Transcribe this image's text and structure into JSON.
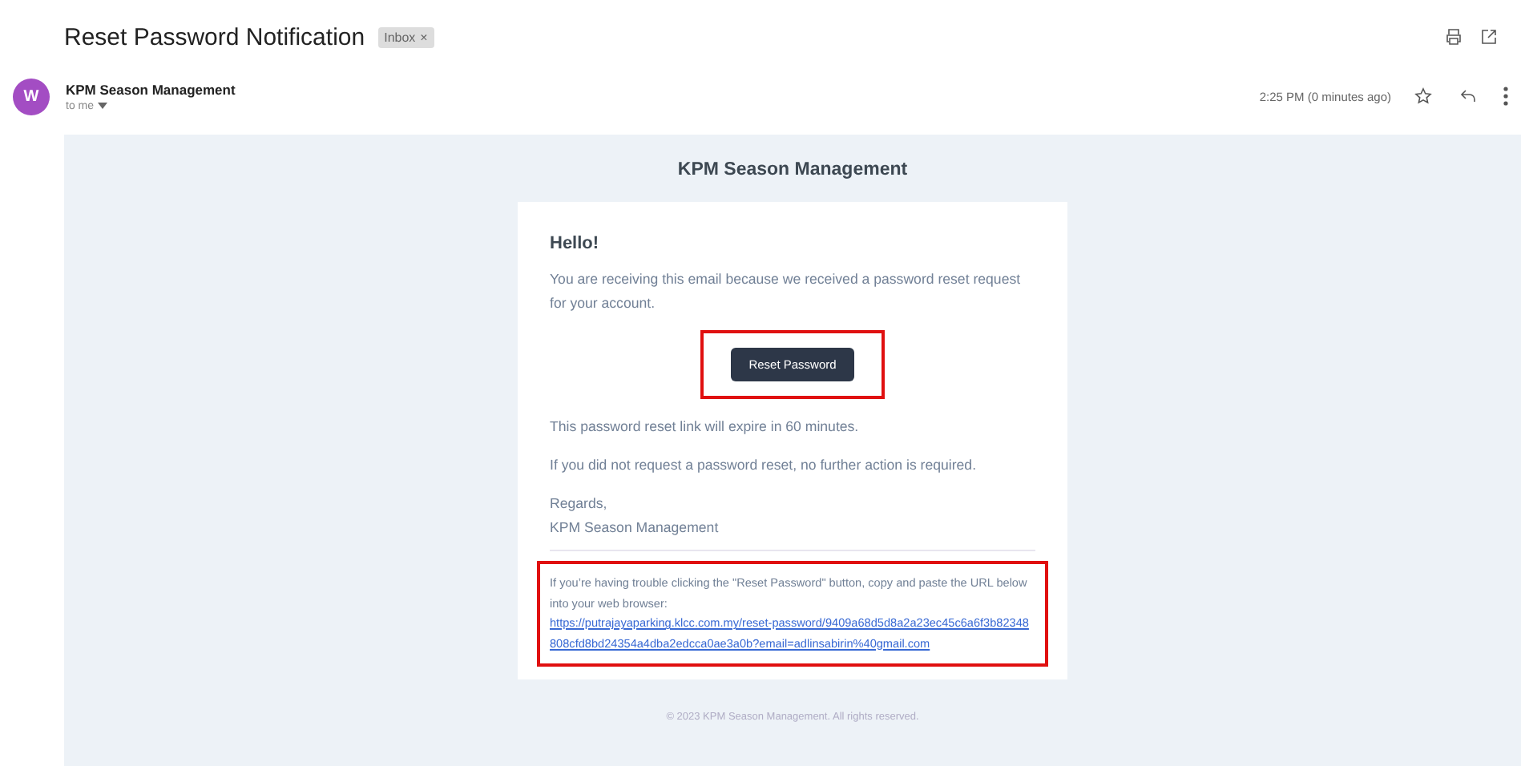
{
  "subject": "Reset Password Notification",
  "label": {
    "text": "Inbox",
    "close": "×"
  },
  "sender": {
    "avatar": "W",
    "name": "KPM Season Management",
    "recipient": "to me"
  },
  "time": "2:25 PM (0 minutes ago)",
  "email": {
    "brand": "KPM Season Management",
    "greeting": "Hello!",
    "intro": "You are receiving this email because we received a password reset request for your account.",
    "button": "Reset Password",
    "button_highlighted": true,
    "lines": [
      "This password reset link will expire in 60 minutes.",
      "If you did not request a password reset, no further action is required."
    ],
    "signoff": [
      "Regards,",
      "KPM Season Management"
    ],
    "trouble": "If you’re having trouble clicking the \"Reset Password\" button, copy and paste the URL below into your web browser:",
    "url": "https://putrajayaparking.klcc.com.my/reset-password/9409a68d5d8a2a23ec45c6a6f3b82348808cfd8bd24354a4dba2edcca0ae3a0b?email=adlinsabirin%40gmail.com",
    "trouble_highlighted": true,
    "footer": "© 2023 KPM Season Management. All rights reserved."
  }
}
